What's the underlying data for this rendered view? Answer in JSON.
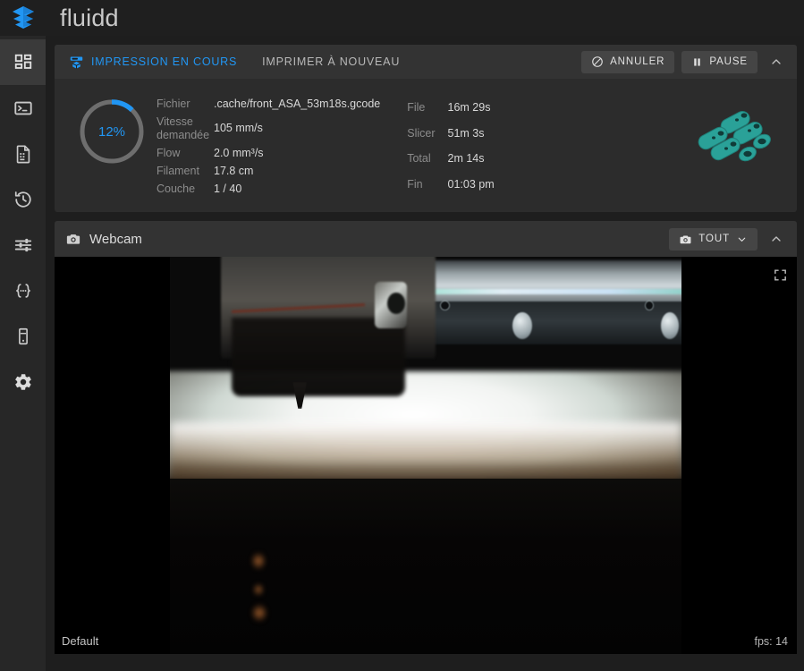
{
  "app": {
    "brand": "fluidd",
    "logo_icon": "fluidd-layers-logo",
    "accent": "#2196f3",
    "card_bg": "#2c2c2c",
    "page_bg": "#1e1e1e"
  },
  "sidebar": {
    "items": [
      {
        "name": "dashboard",
        "icon": "dashboard-grid-icon",
        "active": true
      },
      {
        "name": "console",
        "icon": "terminal-icon",
        "active": false
      },
      {
        "name": "gcode-files",
        "icon": "file-document-icon",
        "active": false
      },
      {
        "name": "history",
        "icon": "history-clock-icon",
        "active": false
      },
      {
        "name": "tune",
        "icon": "tune-sliders-icon",
        "active": false
      },
      {
        "name": "macros",
        "icon": "code-braces-icon",
        "active": false
      },
      {
        "name": "printer",
        "icon": "printer-device-icon",
        "active": false
      },
      {
        "name": "settings",
        "icon": "gear-icon",
        "active": false
      }
    ]
  },
  "status_card": {
    "tab_active": "IMPRESSION EN COURS",
    "tab_active_icon": "printer-3d-icon",
    "tab_inactive": "IMPRIMER À NOUVEAU",
    "cancel_label": "ANNULER",
    "cancel_icon": "cancel-circle-slash-icon",
    "pause_label": "PAUSE",
    "pause_icon": "pause-icon",
    "collapse_icon": "chevron-up-icon",
    "progress_percent": "12%",
    "progress_value": 12,
    "thumbnail_icon": "gcode-model-thumbnail",
    "thumbnail_color": "#2aa198",
    "left_stats": [
      {
        "key": "Fichier",
        "value": ".cache/front_ASA_53m18s.gcode"
      },
      {
        "key": "Vitesse demandée",
        "value": "105 mm/s"
      },
      {
        "key": "Flow",
        "value": "2.0 mm³/s"
      },
      {
        "key": "Filament",
        "value": "17.8 cm"
      },
      {
        "key": "Couche",
        "value": "1 / 40"
      }
    ],
    "right_stats": [
      {
        "key": "File",
        "value": "16m 29s"
      },
      {
        "key": "Slicer",
        "value": "51m 3s"
      },
      {
        "key": "Total",
        "value": "2m 14s"
      },
      {
        "key": "Fin",
        "value": "01:03 pm"
      }
    ]
  },
  "webcam_card": {
    "title": "Webcam",
    "title_icon": "camera-icon",
    "select_label": "TOUT",
    "select_icon": "camera-icon",
    "select_chevron": "chevron-down-icon",
    "collapse_icon": "chevron-up-icon",
    "fullscreen_icon": "fullscreen-expand-icon",
    "stream_name": "Default",
    "fps_label": "fps: 14"
  }
}
